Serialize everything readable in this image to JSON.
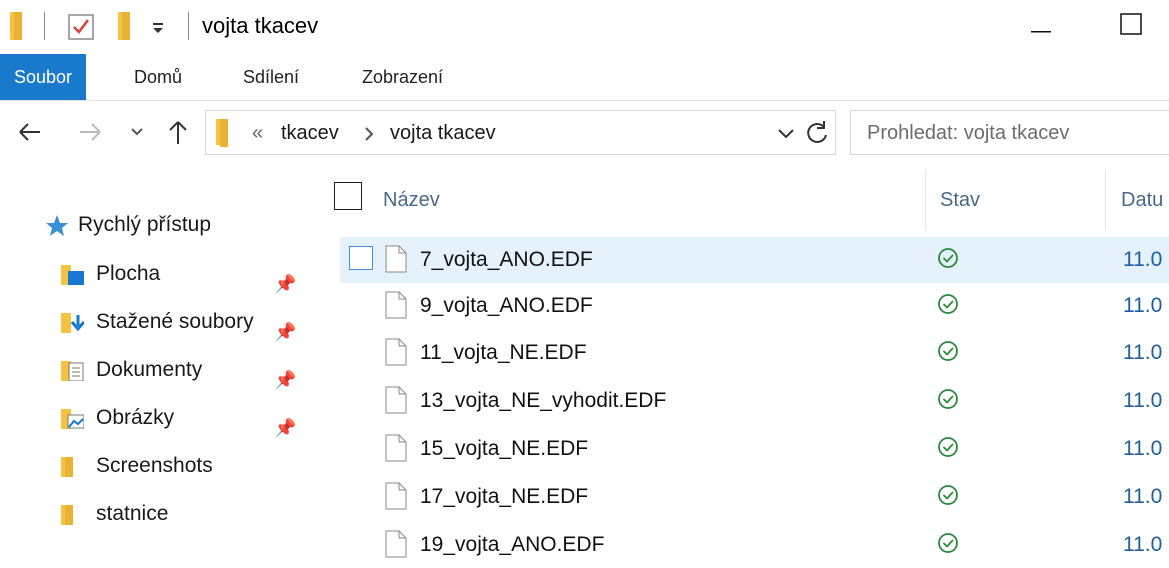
{
  "window": {
    "title": "vojta tkacev",
    "minimize_icon": "minimize-icon",
    "maximize_icon": "maximize-icon"
  },
  "ribbon": {
    "tabs": [
      {
        "label": "Soubor",
        "active": true
      },
      {
        "label": "Domů",
        "active": false
      },
      {
        "label": "Sdílení",
        "active": false
      },
      {
        "label": "Zobrazení",
        "active": false
      }
    ]
  },
  "address": {
    "overflow": "«",
    "crumbs": [
      "tkacev",
      "vojta tkacev"
    ],
    "search_placeholder": "Prohledat: vojta tkacev"
  },
  "sidebar": {
    "quick_access": "Rychlý přístup",
    "items": [
      {
        "label": "Plocha",
        "pinned": true,
        "icon": "desktop-folder-icon"
      },
      {
        "label": "Stažené soubory",
        "pinned": true,
        "icon": "downloads-folder-icon"
      },
      {
        "label": "Dokumenty",
        "pinned": true,
        "icon": "documents-folder-icon"
      },
      {
        "label": "Obrázky",
        "pinned": true,
        "icon": "pictures-folder-icon"
      },
      {
        "label": "Screenshots",
        "pinned": false,
        "icon": "folder-icon"
      },
      {
        "label": "statnice",
        "pinned": false,
        "icon": "folder-icon"
      }
    ]
  },
  "filelist": {
    "columns": [
      "Název",
      "Stav",
      "Datu"
    ],
    "files": [
      {
        "name": "7_vojta_ANO.EDF",
        "date": "11.0",
        "selected": true
      },
      {
        "name": "9_vojta_ANO.EDF",
        "date": "11.0",
        "selected": false
      },
      {
        "name": "11_vojta_NE.EDF",
        "date": "11.0",
        "selected": false
      },
      {
        "name": "13_vojta_NE_vyhodit.EDF",
        "date": "11.0",
        "selected": false
      },
      {
        "name": "15_vojta_NE.EDF",
        "date": "11.0",
        "selected": false
      },
      {
        "name": "17_vojta_NE.EDF",
        "date": "11.0",
        "selected": false
      },
      {
        "name": "19_vojta_ANO.EDF",
        "date": "11.0",
        "selected": false
      }
    ]
  },
  "colors": {
    "accent": "#1979ca",
    "selection": "#e5f1fb",
    "status_green": "#2a8a3e",
    "header_text": "#4a6989"
  }
}
